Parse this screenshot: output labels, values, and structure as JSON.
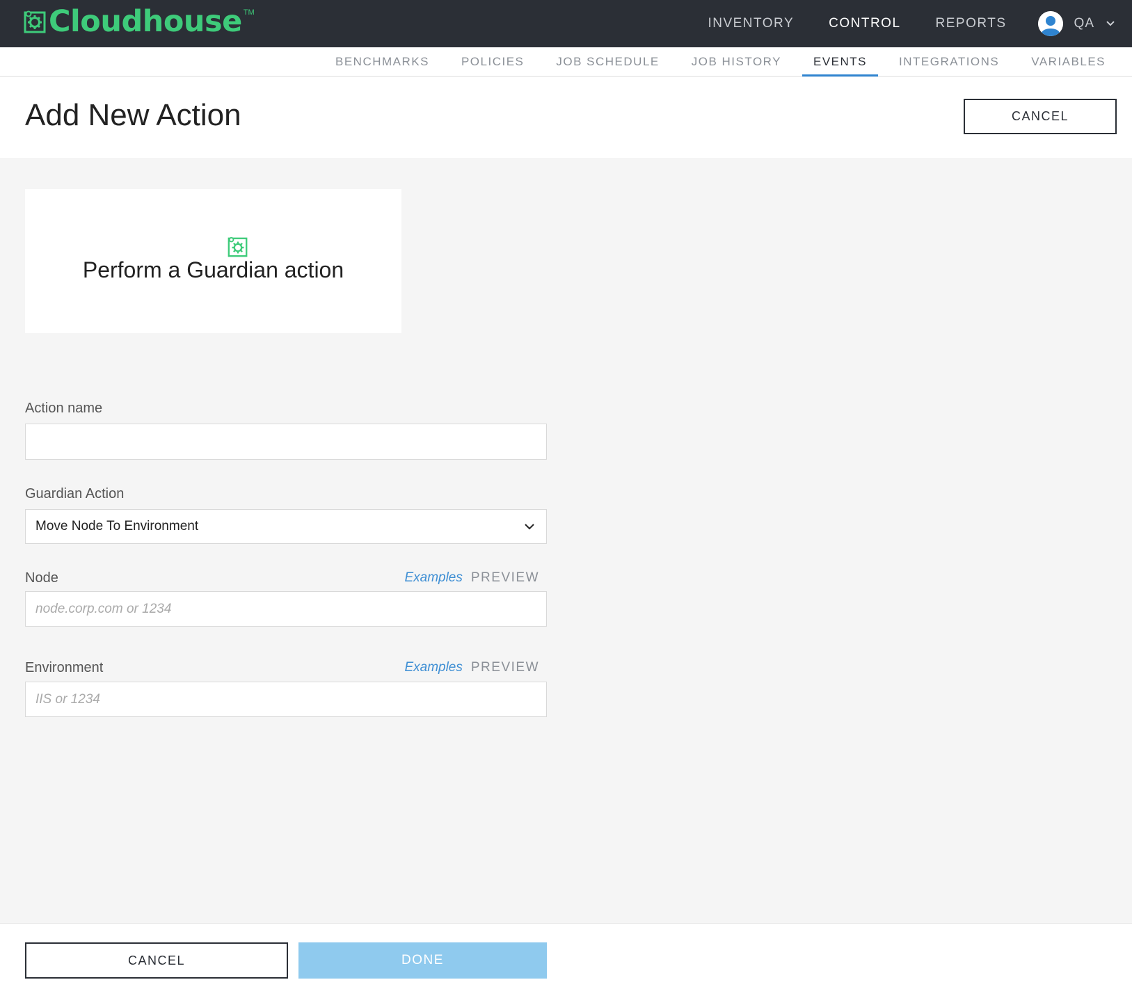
{
  "app": {
    "brand": "Cloudhouse",
    "brand_tm": "TM",
    "brand_color": "#3ecb7a",
    "accent_color": "#2f84d0"
  },
  "mainnav": {
    "items": [
      {
        "label": "INVENTORY",
        "active": false
      },
      {
        "label": "CONTROL",
        "active": true
      },
      {
        "label": "REPORTS",
        "active": false
      }
    ],
    "user": {
      "name": "QA",
      "icon": "user-avatar-icon"
    }
  },
  "subnav": {
    "items": [
      {
        "label": "BENCHMARKS",
        "active": false
      },
      {
        "label": "POLICIES",
        "active": false
      },
      {
        "label": "JOB SCHEDULE",
        "active": false
      },
      {
        "label": "JOB HISTORY",
        "active": false
      },
      {
        "label": "EVENTS",
        "active": true
      },
      {
        "label": "INTEGRATIONS",
        "active": false
      },
      {
        "label": "VARIABLES",
        "active": false
      }
    ]
  },
  "header": {
    "title": "Add New Action",
    "cancel_label": "CANCEL"
  },
  "action_card": {
    "icon": "guardian-gear-icon",
    "label": "Perform a Guardian action"
  },
  "form": {
    "action_name": {
      "label": "Action name",
      "value": "",
      "placeholder": ""
    },
    "guardian_action": {
      "label": "Guardian Action",
      "value": "Move Node To Environment"
    },
    "node": {
      "label": "Node",
      "placeholder": "node.corp.com or 1234",
      "examples": "Examples",
      "preview": "PREVIEW"
    },
    "environment": {
      "label": "Environment",
      "placeholder": "IIS or 1234",
      "examples": "Examples",
      "preview": "PREVIEW"
    }
  },
  "footer": {
    "cancel_label": "CANCEL",
    "done_label": "DONE"
  }
}
